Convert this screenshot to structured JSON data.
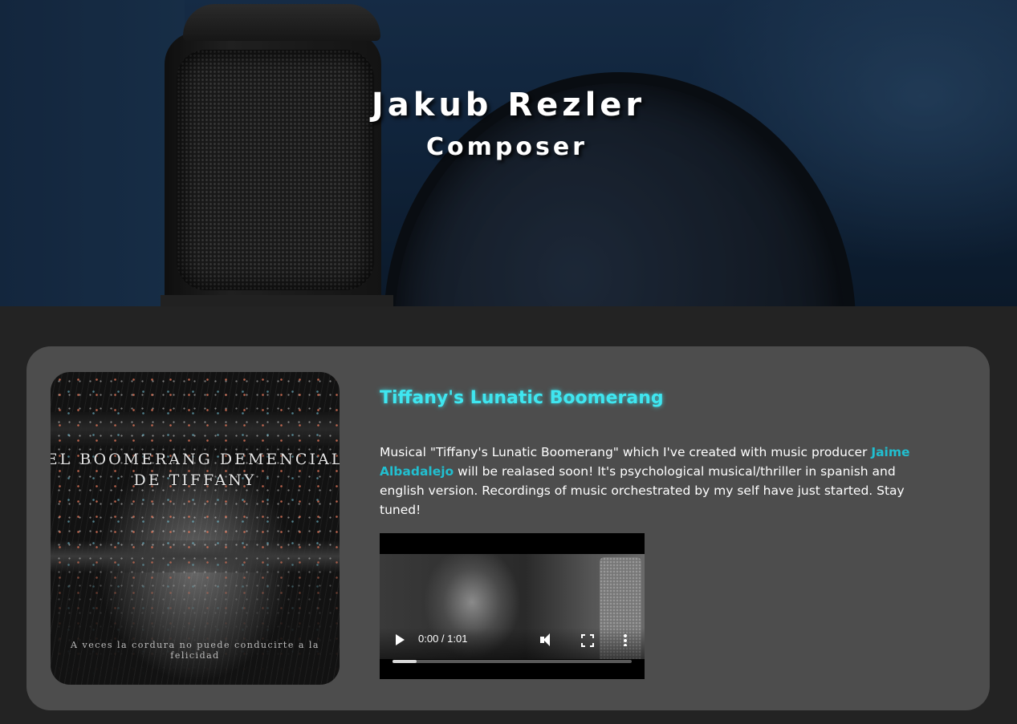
{
  "hero": {
    "name": "Jakub Rezler",
    "role": "Composer"
  },
  "project": {
    "title": "Tiffany's Lunatic Boomerang",
    "description_before": "Musical \"Tiffany's Lunatic Boomerang\" which I've created with music producer ",
    "producer_link": "Jaime Albadalejo",
    "description_after": " will be realased soon! It's psychological musical/thriller in spanish and english version. Recordings of music orchestrated by my self have just started. Stay tuned!",
    "cover": {
      "title": "EL BOOMERANG DEMENCIAL\nDE TIFFANY",
      "tagline": "A veces la cordura no puede conducirte a la felicidad"
    },
    "video": {
      "time": "0:00 / 1:01",
      "buffered_fraction": 0.1,
      "icons": [
        "play-icon",
        "volume-icon",
        "fullscreen-icon",
        "more-options-icon"
      ]
    }
  },
  "colors": {
    "accent": "#3fe6f0",
    "link": "#21bfd0",
    "card_bg": "#4d4d4d",
    "page_bg": "#232323"
  }
}
